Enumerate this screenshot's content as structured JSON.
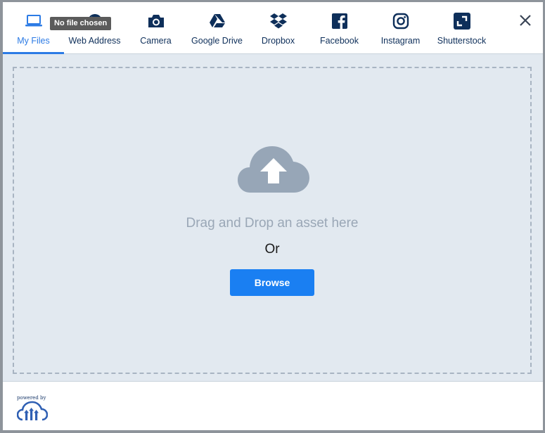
{
  "tabs": [
    {
      "label": "My Files",
      "icon": "laptop-icon",
      "active": true
    },
    {
      "label": "Web Address",
      "icon": "globe-icon",
      "active": false
    },
    {
      "label": "Camera",
      "icon": "camera-icon",
      "active": false
    },
    {
      "label": "Google Drive",
      "icon": "google-drive-icon",
      "active": false
    },
    {
      "label": "Dropbox",
      "icon": "dropbox-icon",
      "active": false
    },
    {
      "label": "Facebook",
      "icon": "facebook-icon",
      "active": false
    },
    {
      "label": "Instagram",
      "icon": "instagram-icon",
      "active": false
    },
    {
      "label": "Shutterstock",
      "icon": "shutterstock-icon",
      "active": false
    }
  ],
  "tooltip": "No file chosen",
  "dropzone": {
    "drag_text": "Drag and Drop an asset here",
    "or_text": "Or",
    "browse_label": "Browse"
  },
  "footer": {
    "powered_by": "powered by"
  },
  "colors": {
    "accent": "#2c7be5",
    "nav_text": "#0e2f5a",
    "button": "#1a7ff2",
    "dropzone_bg": "#e2e9f0",
    "cloud": "#97a6b7"
  }
}
